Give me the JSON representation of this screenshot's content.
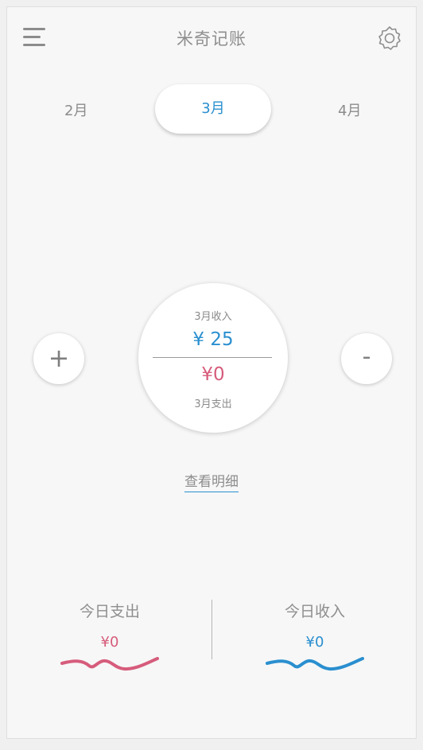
{
  "header": {
    "title": "米奇记账",
    "menu_icon": "menu-icon",
    "settings_icon": "gear-icon"
  },
  "months": {
    "prev": "2月",
    "current": "3月",
    "next": "4月"
  },
  "summary": {
    "income_label": "3月收入",
    "income_amount": "¥ 25",
    "expense_amount": "¥0",
    "expense_label": "3月支出"
  },
  "actions": {
    "add_label": "+",
    "subtract_label": "-",
    "detail_link": "查看明细"
  },
  "today": {
    "expense_label": "今日支出",
    "expense_value": "¥0",
    "income_label": "今日收入",
    "income_value": "¥0"
  },
  "colors": {
    "income": "#2a8fcf",
    "expense": "#d65c7b",
    "text": "#8e8e8e",
    "background": "#f7f7f7"
  }
}
